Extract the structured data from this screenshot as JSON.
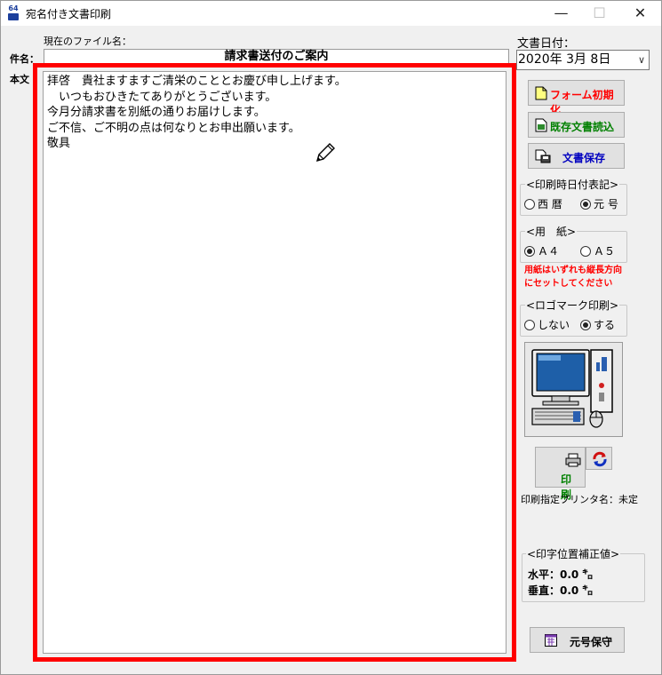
{
  "window": {
    "title": "宛名付き文書印刷",
    "minimize_label": "—",
    "maximize_label": "☐",
    "close_label": "✕"
  },
  "form": {
    "current_file_label": "現在のファイル名：",
    "subject_label": "件名：",
    "subject_value": "請求書送付のご案内",
    "body_label": "本文",
    "body_text": "拝啓　貴社ますますご清栄のこととお慶び申し上げます。\n　いつもおひきたてありがとうございます。\n今月分請求書を別紙の通りお届けします。\nご不信、ご不明の点は何なりとお申出願います。\n敬具"
  },
  "date": {
    "label": "文書日付：",
    "value": "2020年  3月  8日"
  },
  "buttons": {
    "form_init": "フォーム初期化",
    "load_doc": "既存文書読込",
    "save_doc": "文書保存",
    "print": "印 刷",
    "gengo_save": "元号保守"
  },
  "colors": {
    "form_init_text": "#ff0000",
    "load_doc_text": "#008000",
    "save_doc_text": "#0000c0",
    "print_text": "#008000",
    "highlight_frame": "#ff0000",
    "warning_text": "#ff0000"
  },
  "print_date_format": {
    "title": "<印刷時日付表記>",
    "options": [
      "西 暦",
      "元 号"
    ],
    "selected": "元 号"
  },
  "paper": {
    "title": "<用　紙>",
    "options": [
      "Ａ４",
      "Ａ５"
    ],
    "selected": "Ａ４",
    "warning_line1": "用紙はいずれも縦長方向",
    "warning_line2": "にセットしてください"
  },
  "logo_print": {
    "title": "<ロゴマーク印刷>",
    "options": [
      "しない",
      "する"
    ],
    "selected": "する"
  },
  "printer": {
    "label": "印刷指定プリンタ名：未定"
  },
  "offset": {
    "title": "<印字位置補正値>",
    "horizontal": "水平：0.0 ㌔",
    "vertical": "垂直：0.0 ㌔"
  }
}
